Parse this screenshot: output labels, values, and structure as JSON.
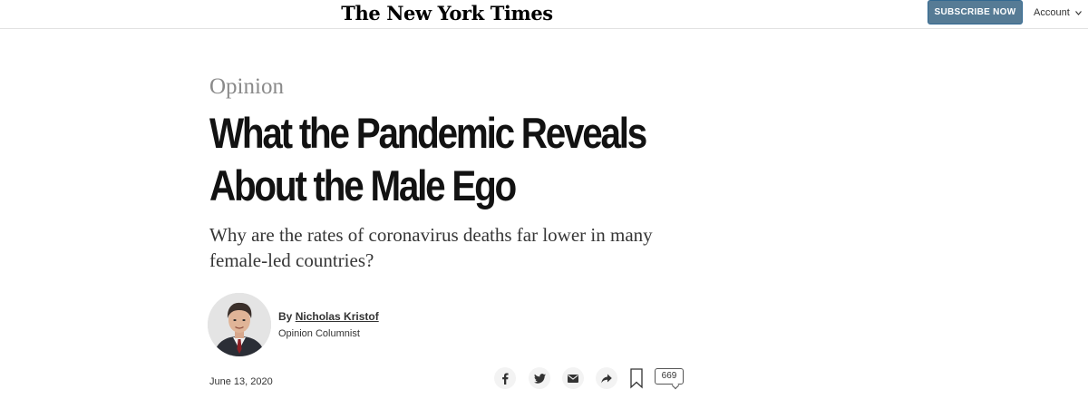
{
  "header": {
    "logo_text": "The New York Times",
    "subscribe_label": "SUBSCRIBE NOW",
    "account_label": "Account"
  },
  "article": {
    "kicker": "Opinion",
    "headline": "What the Pandemic Reveals About the Male Ego",
    "summary": "Why are the rates of coronavirus deaths far lower in many female-led countries?",
    "byline_prefix": "By",
    "author": "Nicholas Kristof",
    "author_role": "Opinion Columnist",
    "date": "June 13, 2020"
  },
  "share": {
    "icons": [
      "facebook-icon",
      "twitter-icon",
      "email-icon",
      "share-arrow-icon",
      "bookmark-icon",
      "comment-icon"
    ],
    "comment_count": "669"
  },
  "colors": {
    "subscribe_bg": "#567b95",
    "text": "#121212",
    "kicker": "#8a8a8a"
  }
}
